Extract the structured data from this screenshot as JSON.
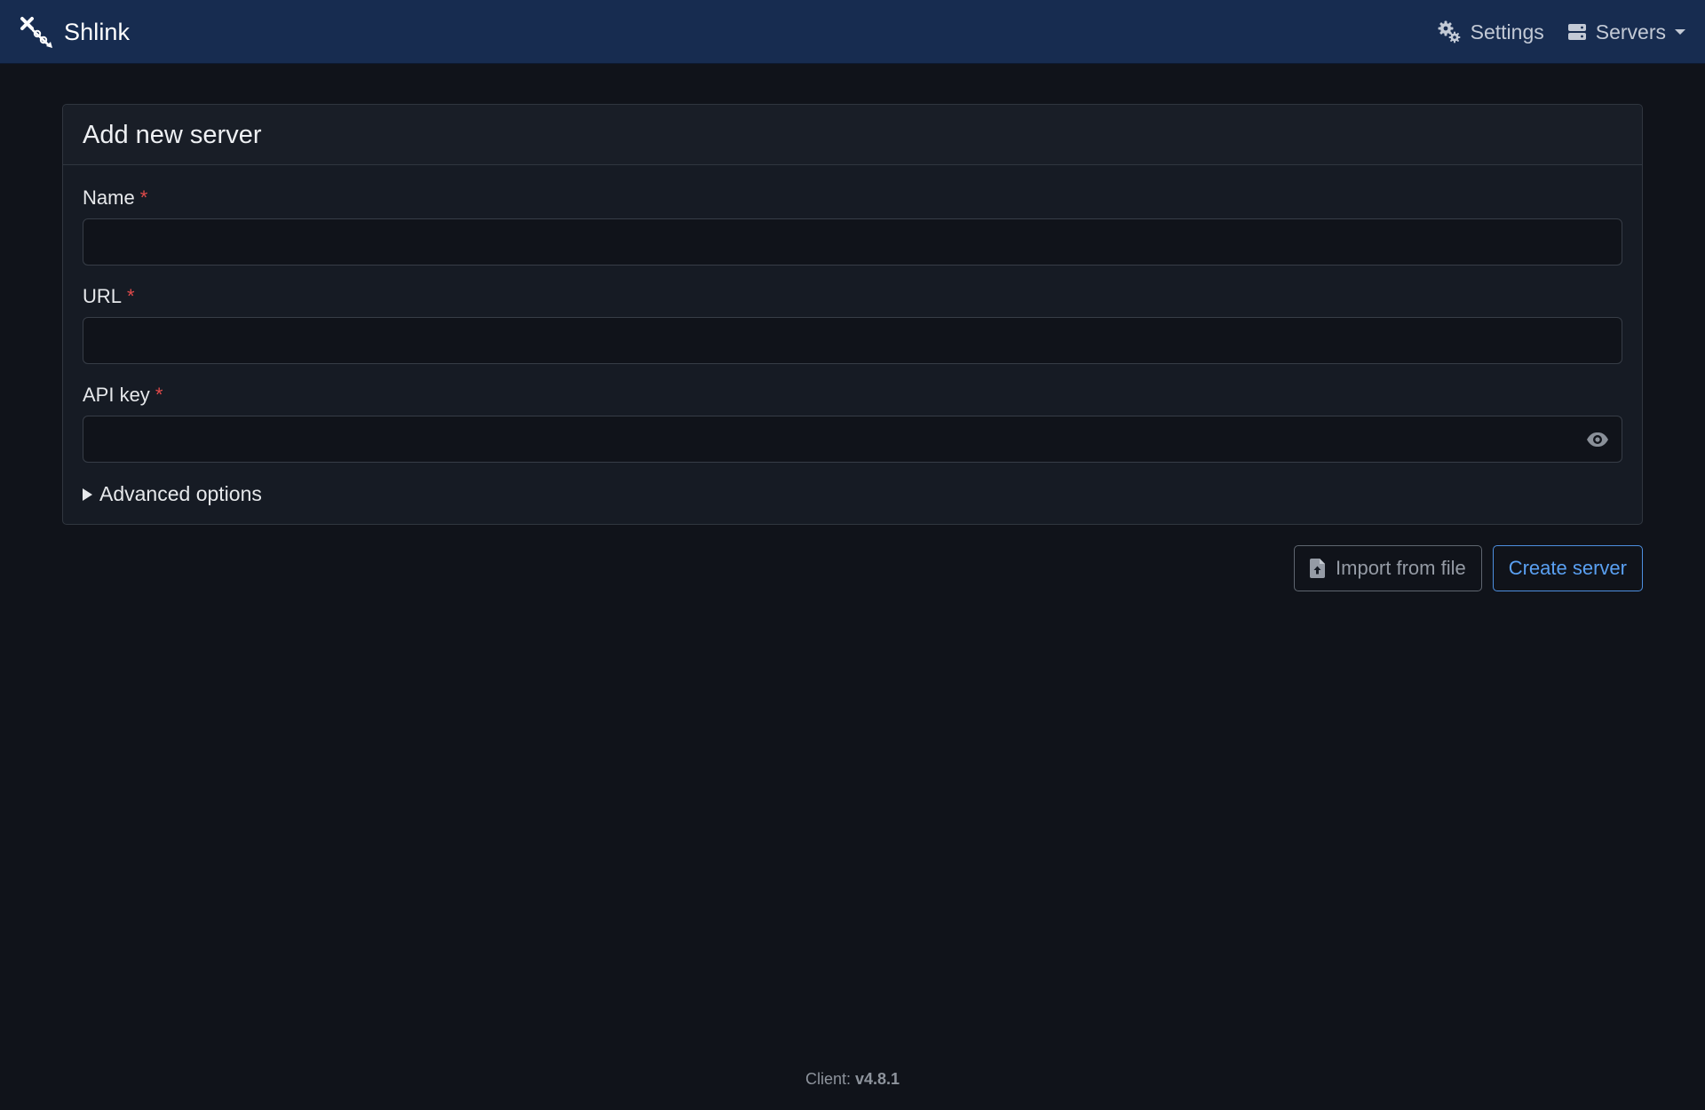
{
  "app": {
    "name": "Shlink",
    "logo_icon": "shlink-logo-icon"
  },
  "nav": {
    "settings_label": "Settings",
    "settings_icon": "gears-icon",
    "servers_label": "Servers",
    "servers_icon": "server-icon"
  },
  "form": {
    "title": "Add new server",
    "required_marker": "*",
    "fields": [
      {
        "label": "Name",
        "value": "",
        "placeholder": ""
      },
      {
        "label": "URL",
        "value": "",
        "placeholder": ""
      },
      {
        "label": "API key",
        "value": "",
        "placeholder": "",
        "toggle_icon": "eye-icon"
      }
    ],
    "advanced_label": "Advanced options"
  },
  "actions": {
    "import_label": "Import from file",
    "import_icon": "file-upload-icon",
    "create_label": "Create server"
  },
  "footer": {
    "prefix": "Client:",
    "version": "v4.8.1"
  },
  "colors": {
    "navbar_bg": "#172c50",
    "page_bg": "#10131a",
    "card_bg": "#161b24",
    "required": "#e04a4a",
    "primary": "#5aa0f2"
  }
}
